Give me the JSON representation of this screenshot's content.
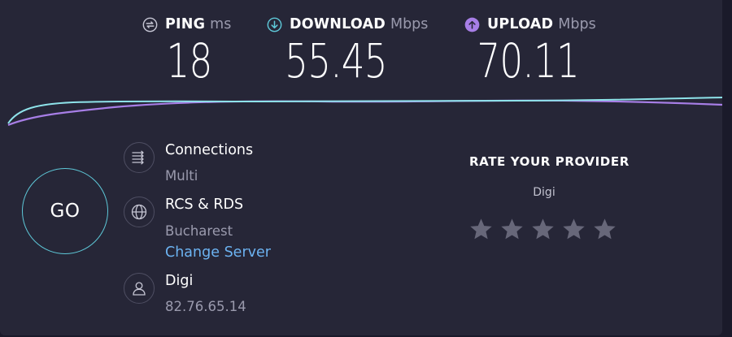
{
  "metrics": {
    "ping": {
      "label": "PING",
      "unit": "ms",
      "value": "18",
      "icon": "ping-icon",
      "color": "#c6c6d4"
    },
    "download": {
      "label": "DOWNLOAD",
      "unit": "Mbps",
      "value": "55.45",
      "icon": "download-arrow-icon",
      "color": "#5ec8d8"
    },
    "upload": {
      "label": "UPLOAD",
      "unit": "Mbps",
      "value": "70.11",
      "icon": "upload-arrow-icon",
      "color": "#a77ee6"
    }
  },
  "go_button": {
    "label": "GO",
    "ring_color": "#5ec8d8"
  },
  "connections": {
    "title": "Connections",
    "value": "Multi",
    "icon": "connections-icon"
  },
  "server": {
    "name": "RCS & RDS",
    "location": "Bucharest",
    "change_label": "Change Server",
    "icon": "globe-icon"
  },
  "isp": {
    "name": "Digi",
    "ip": "82.76.65.14",
    "icon": "user-icon"
  },
  "rating": {
    "title": "RATE YOUR PROVIDER",
    "provider": "Digi",
    "stars_total": 5,
    "stars_filled": 0,
    "icon": "star-icon"
  },
  "colors": {
    "background": "#262637",
    "accent_download": "#5ec8d8",
    "accent_upload": "#a77ee6",
    "link": "#6cb3f2"
  }
}
